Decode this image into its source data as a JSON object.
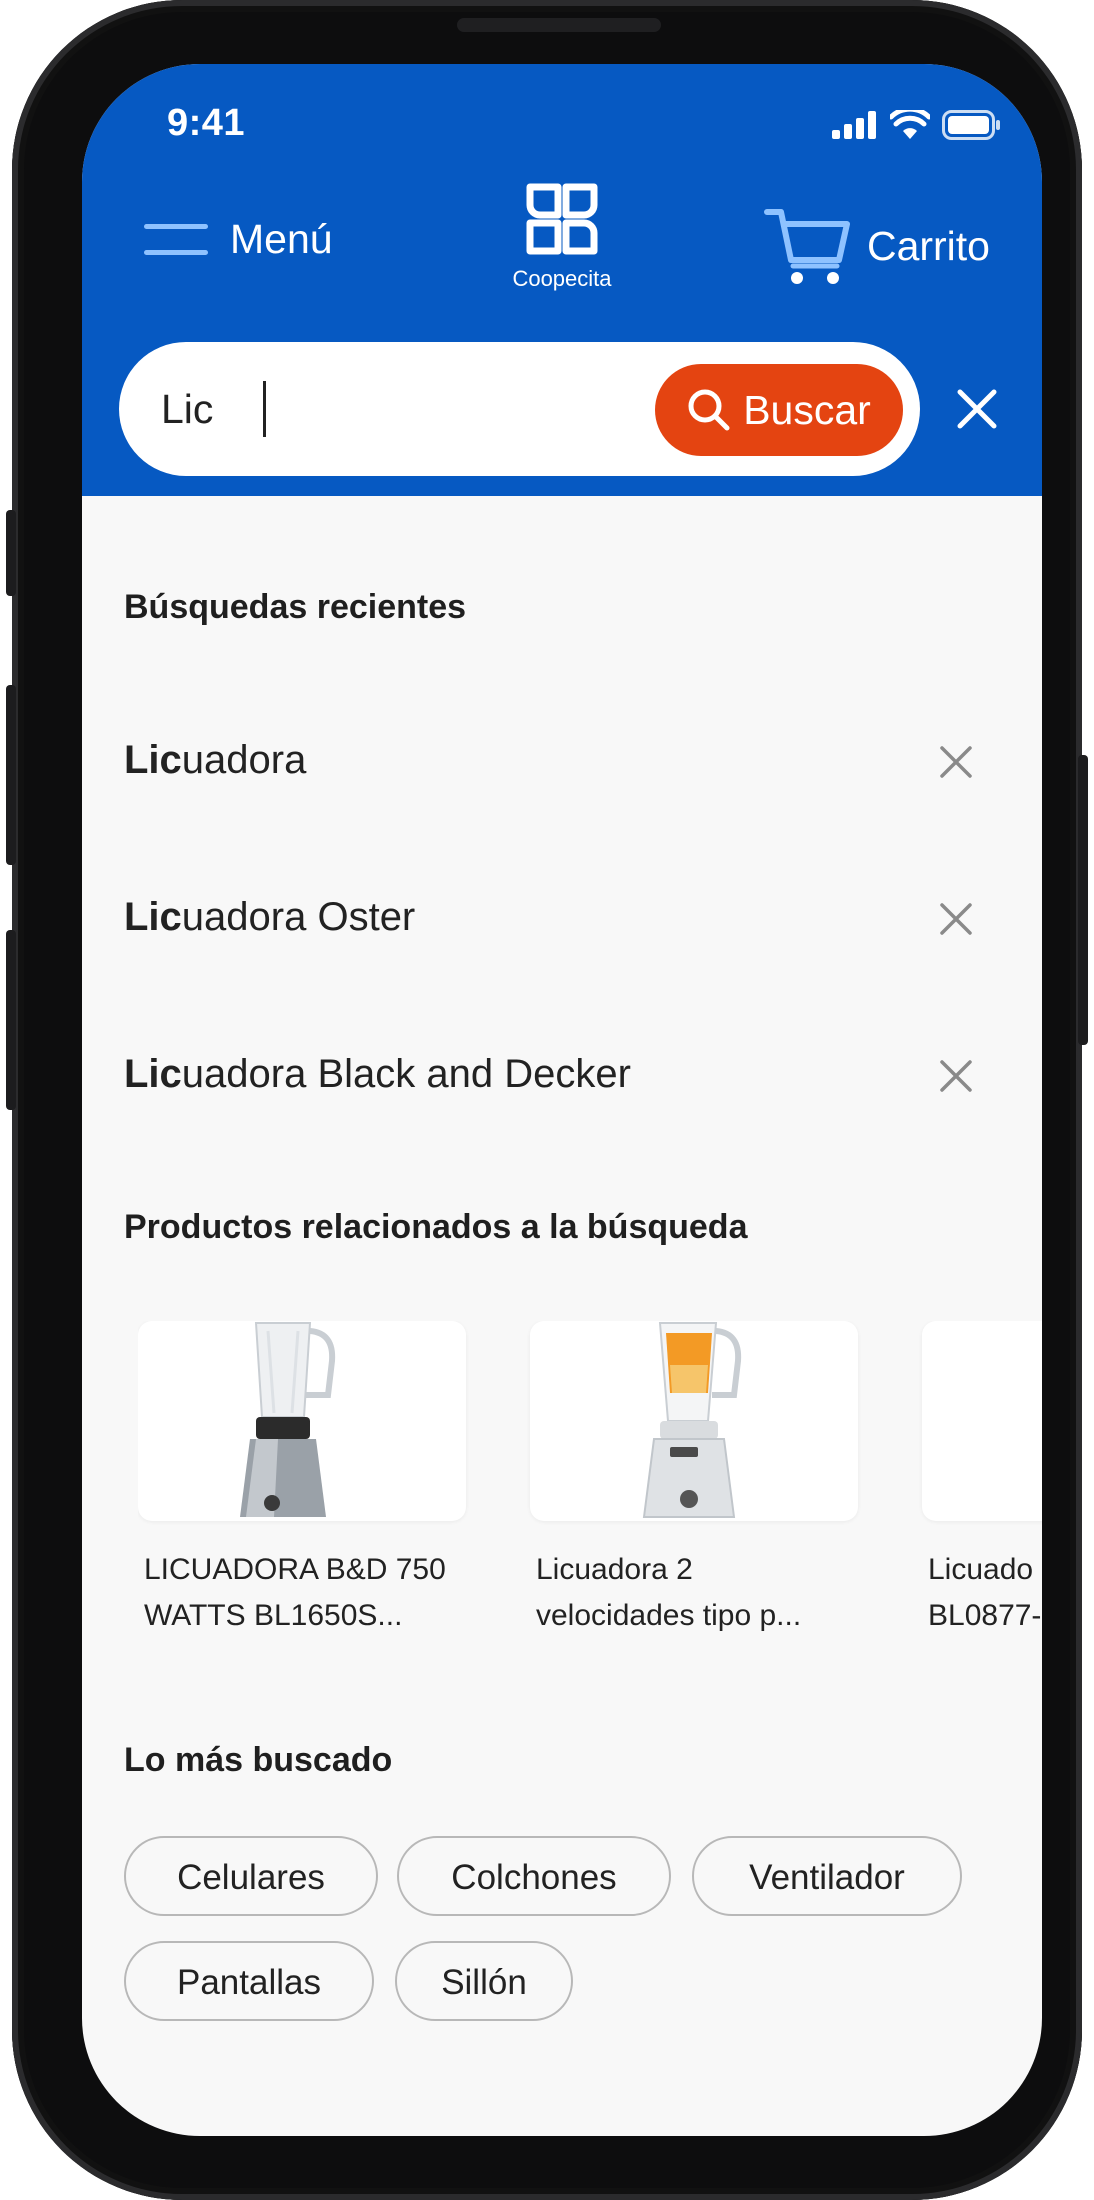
{
  "status_bar": {
    "time": "9:41"
  },
  "header": {
    "menu_label": "Menú",
    "logo_text": "Coopecita",
    "cart_label": "Carrito"
  },
  "search": {
    "value": "Lic",
    "button_label": "Buscar"
  },
  "recent": {
    "title": "Búsquedas recientes",
    "items": [
      {
        "match": "Lic",
        "rest": "uadora"
      },
      {
        "match": "Lic",
        "rest": "uadora Oster"
      },
      {
        "match": "Lic",
        "rest": "uadora Black and Decker"
      }
    ]
  },
  "related": {
    "title": "Productos relacionados a la búsqueda",
    "products": [
      {
        "name_line1": "LICUADORA B&D 750",
        "name_line2": "WATTS BL1650S..."
      },
      {
        "name_line1": "Licuadora 2",
        "name_line2": "velocidades tipo p..."
      },
      {
        "name_line1": "Licuado",
        "name_line2": "BL0877-"
      }
    ]
  },
  "popular": {
    "title": "Lo más buscado",
    "chips": [
      "Celulares",
      "Colchones",
      "Ventilador",
      "Pantallas",
      "Sillón"
    ]
  },
  "colors": {
    "brand_blue": "#0659c2",
    "accent_orange": "#e44411",
    "background": "#f8f8f8"
  }
}
